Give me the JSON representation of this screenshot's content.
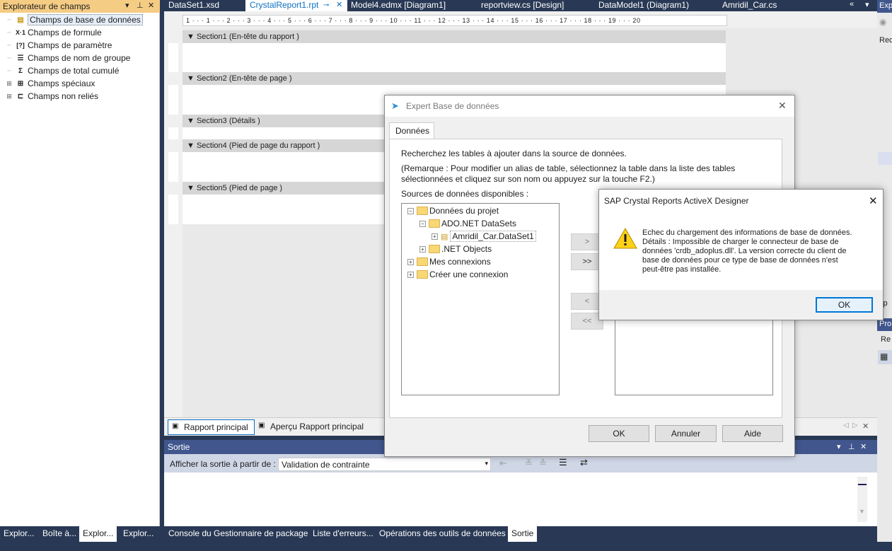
{
  "field_explorer": {
    "title": "Explorateur de champs",
    "items": [
      {
        "label": "Champs de base de données",
        "icon": "database-field-icon",
        "glyph": "▤",
        "selected": true
      },
      {
        "label": "Champs de formule",
        "icon": "formula-icon",
        "glyph": "X·1"
      },
      {
        "label": "Champs de paramètre",
        "icon": "parameter-icon",
        "glyph": "[?]"
      },
      {
        "label": "Champs de nom de groupe",
        "icon": "group-name-icon",
        "glyph": "☰"
      },
      {
        "label": "Champs de total cumulé",
        "icon": "running-total-icon",
        "glyph": "Σ"
      },
      {
        "label": "Champs spéciaux",
        "icon": "special-field-icon",
        "glyph": "⊞"
      },
      {
        "label": "Champs non reliés",
        "icon": "unbound-field-icon",
        "glyph": "⊏"
      }
    ]
  },
  "doc_tabs": [
    "DataSet1.xsd",
    "CrystalReport1.rpt",
    "Model4.edmx [Diagram1]",
    "reportview.cs [Design]",
    "DataModel1 (Diagram1)",
    "Amridil_Car.cs"
  ],
  "ruler_text": "1 · · · 1 · · · 2 · · · 3 · · · 4 · · · 5 · · · 6 · · · 7 · · · 8 · · · 9 · · · 10 · · · 11 · · · 12 · · · 13 · · · 14 · · · 15 · · · 16 · · · 17 · · · 18 · · · 19 · · · 20",
  "sections": [
    "Section1 (En-tête du rapport  )",
    "Section2 (En-tête de page  )",
    "Section3 (Détails  )",
    "Section4 (Pied de page du rapport  )",
    "Section5 (Pied de page  )"
  ],
  "report_tabs": [
    "Rapport principal",
    "Aperçu Rapport principal"
  ],
  "output": {
    "title": "Sortie",
    "show_from_label": "Afficher la sortie à partir de :",
    "source_value": "Validation de contrainte"
  },
  "bottom_tabs_left": [
    "Explor...",
    "Boîte à...",
    "Explor...",
    "Explor..."
  ],
  "bottom_tabs_right": [
    "Console du Gestionnaire de package",
    "Liste d'erreurs...",
    "Opérations des outils de données",
    "Sortie"
  ],
  "right_panel": {
    "labels": [
      "Explor",
      "Rec",
      "xp",
      "Pro",
      "Re"
    ]
  },
  "db_expert": {
    "title": "Expert Base de données",
    "tab": "Données",
    "intro": "Recherchez les tables à ajouter dans la source de données.",
    "note_line1": "(Remarque : Pour modifier un alias de table, sélectionnez la table dans la liste des tables",
    "note_line2": "sélectionnées et cliquez sur son nom ou appuyez sur la touche F2.)",
    "available_label": "Sources de données disponibles :",
    "tree": [
      {
        "label": "Données du projet",
        "level": 0,
        "sign": "−"
      },
      {
        "label": "ADO.NET DataSets",
        "level": 1,
        "sign": "−"
      },
      {
        "label": "Amridil_Car.DataSet1",
        "level": 2,
        "sign": "+"
      },
      {
        "label": ".NET Objects",
        "level": 1,
        "sign": "+"
      },
      {
        "label": "Mes connexions",
        "level": 0,
        "sign": "+"
      },
      {
        "label": "Créer une connexion",
        "level": 0,
        "sign": "+"
      }
    ],
    "move_buttons": [
      ">",
      ">>",
      "<",
      "<<"
    ],
    "ok": "OK",
    "cancel": "Annuler",
    "help": "Aide"
  },
  "error_dialog": {
    "title": "SAP Crystal Reports ActiveX Designer",
    "message_lines": [
      "Echec du chargement des informations de base de données.",
      "Détails : Impossible de charger le connecteur de base de",
      "données 'crdb_adoplus.dll'. La version correcte du client de",
      "base de données pour ce type de base de données n'est",
      "peut-être pas installée."
    ],
    "ok": "OK"
  }
}
